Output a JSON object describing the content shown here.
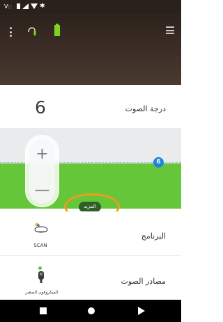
{
  "status_bar": {
    "text": "V::",
    "icons": [
      "square-icon",
      "signal-icon",
      "wifi-icon",
      "bluetooth-icon"
    ]
  },
  "header": {
    "icons": [
      "kebab-menu-icon",
      "hearing-aid-icon",
      "battery-icon",
      "hamburger-menu-icon"
    ],
    "battery_color": "#7ed321"
  },
  "volume": {
    "value": "6",
    "label": "درجة الصوت"
  },
  "slider": {
    "level": "6",
    "plus": "+",
    "minus": "—",
    "more_label": "المزيد",
    "highlight_color": "#f39a1f",
    "fill_color": "#65c63a",
    "badge_color": "#1f86d9"
  },
  "program": {
    "icon_text": "SCAN",
    "label": "البرنامج"
  },
  "sound_source": {
    "icon_text": "الميكروفون الصغير",
    "label": "مصادر الصوت",
    "indicator_color": "#65c63a"
  },
  "nav": {
    "icons": [
      "recents-icon",
      "home-icon",
      "back-icon"
    ]
  }
}
